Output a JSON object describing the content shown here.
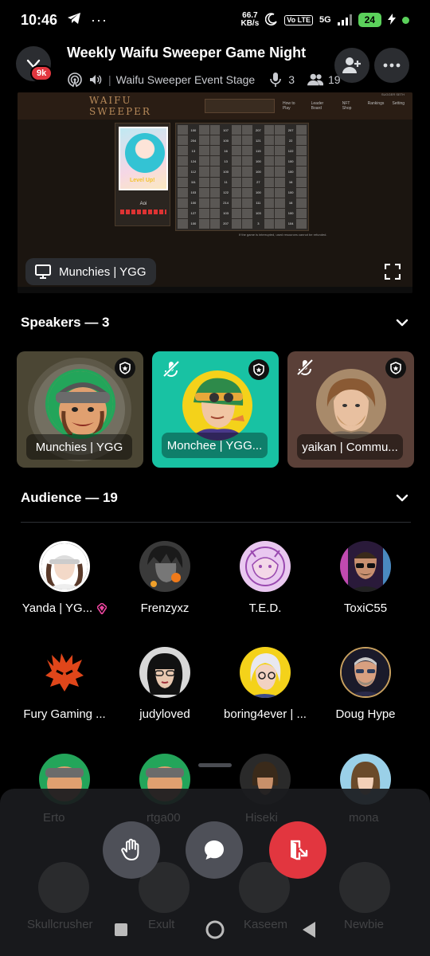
{
  "status_bar": {
    "time": "10:46",
    "speed_value": "66.7",
    "speed_unit": "KB/s",
    "vo_badge": "Vo LTE",
    "network": "5G",
    "battery": "24"
  },
  "header": {
    "title": "Weekly Waifu Sweeper Game Night",
    "notification_badge": "9k",
    "stage_name": "Waifu Sweeper Event Stage",
    "speaker_count": "3",
    "listener_count": "19"
  },
  "stream": {
    "game_logo": "WAIFU SWEEPER",
    "streamer_label": "Munchies | YGG",
    "card_name": "Aoi",
    "card_tag": "Level Up!",
    "footer_note": "If the game is interrupted, used resources cannot be refunded.",
    "top_right_label": "SUGGER SETH",
    "menu": [
      "How to Play",
      "Leader Board",
      "NFT Shop",
      "Rankings",
      "Setting"
    ],
    "grid_numbers": [
      "100",
      "107",
      "207",
      "207",
      "204",
      "100",
      "121",
      "22",
      "13",
      "16",
      "115",
      "122",
      "124",
      "13",
      "100",
      "100",
      "112",
      "100",
      "100",
      "100",
      "111",
      "11",
      "27",
      "16",
      "103",
      "122",
      "100",
      "100",
      "100",
      "214",
      "111",
      "16",
      "127",
      "103",
      "103",
      "100",
      "100",
      "207",
      "3",
      "104"
    ]
  },
  "speakers": {
    "heading": "Speakers — 3",
    "items": [
      {
        "name": "Munchies | YGG"
      },
      {
        "name": "Monchee | YGG..."
      },
      {
        "name": "yaikan | Commu..."
      }
    ]
  },
  "audience": {
    "heading": "Audience — 19",
    "items": [
      {
        "name": "Yanda | YG..."
      },
      {
        "name": "Frenzyxz"
      },
      {
        "name": "T.E.D."
      },
      {
        "name": "ToxiC55"
      },
      {
        "name": "Fury Gaming ..."
      },
      {
        "name": "judyloved"
      },
      {
        "name": "boring4ever | ..."
      },
      {
        "name": "Doug Hype"
      },
      {
        "name": "Erto"
      },
      {
        "name": "rtga00"
      },
      {
        "name": "Hiseki"
      },
      {
        "name": "mona"
      },
      {
        "name": "Skullcrusher"
      },
      {
        "name": "Exult"
      },
      {
        "name": "Kaseem"
      },
      {
        "name": "Newbie"
      }
    ]
  },
  "colors": {
    "accent_teal": "#18c2a3",
    "danger_red": "#e2363f",
    "online_green": "#23a55a",
    "nitro_pink": "#eb459e"
  }
}
